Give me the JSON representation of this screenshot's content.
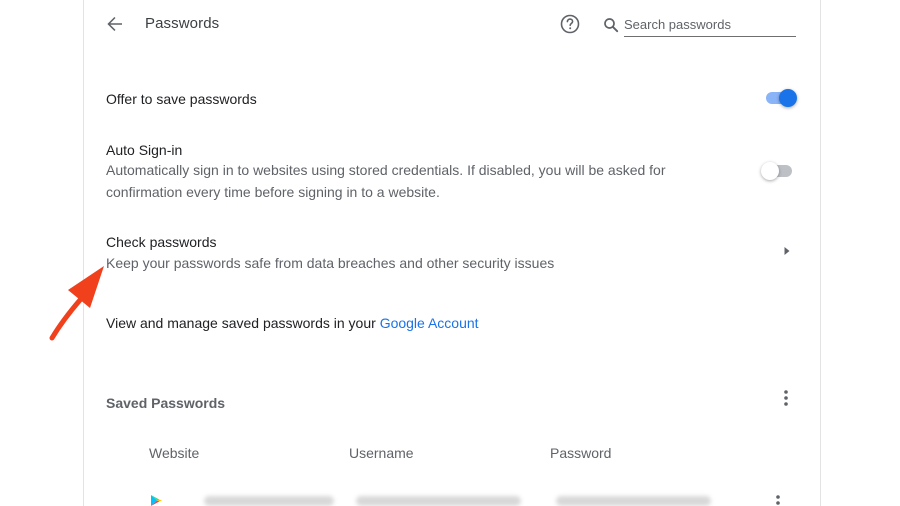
{
  "header": {
    "title": "Passwords",
    "search_placeholder": "Search passwords"
  },
  "settings": {
    "offer_to_save": {
      "label": "Offer to save passwords",
      "enabled": true
    },
    "auto_signin": {
      "label": "Auto Sign-in",
      "description": "Automatically sign in to websites using stored credentials. If disabled, you will be asked for confirmation every time before signing in to a website.",
      "enabled": false
    },
    "check_passwords": {
      "label": "Check passwords",
      "description": "Keep your passwords safe from data breaches and other security issues"
    },
    "manage": {
      "text_prefix": "View and manage saved passwords in your ",
      "link_text": "Google Account"
    }
  },
  "saved_passwords": {
    "title": "Saved Passwords",
    "columns": [
      "Website",
      "Username",
      "Password"
    ]
  },
  "colors": {
    "accent": "#1a73e8",
    "toggle_track_on": "#8ab4f8",
    "annotation_arrow": "#f0401c"
  },
  "icons": {
    "back": "arrow-left-icon",
    "help": "help-circle-icon",
    "search": "search-icon",
    "chevron": "chevron-right-icon",
    "more": "more-vertical-icon",
    "site": "google-play-icon"
  }
}
